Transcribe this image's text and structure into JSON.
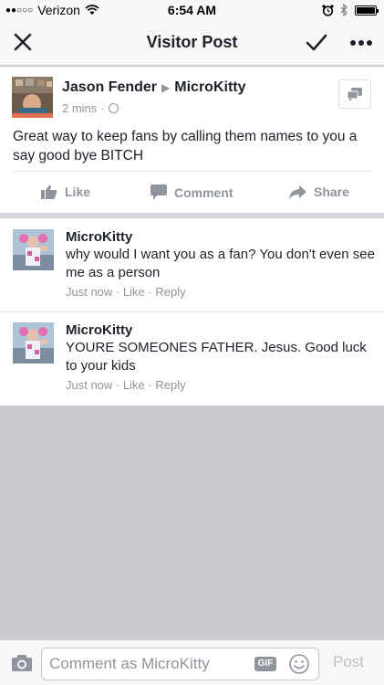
{
  "status_bar": {
    "signal_dots": "●●○○○",
    "carrier": "Verizon",
    "time": "6:54 AM"
  },
  "nav": {
    "title": "Visitor Post"
  },
  "post": {
    "author": "Jason Fender",
    "target": "MicroKitty",
    "time": "2 mins",
    "text": "Great way to keep fans by calling them names to you a say good bye BITCH",
    "actions": {
      "like": "Like",
      "comment": "Comment",
      "share": "Share"
    }
  },
  "comments": [
    {
      "author": "MicroKitty",
      "text": "why would I want you as a fan? You don't even see me as a person",
      "time": "Just now",
      "like": "Like",
      "reply": "Reply"
    },
    {
      "author": "MicroKitty",
      "text": "YOURE SOMEONES FATHER. Jesus. Good luck to your kids",
      "time": "Just now",
      "like": "Like",
      "reply": "Reply"
    }
  ],
  "composer": {
    "placeholder": "Comment as MicroKitty",
    "gif_label": "GIF",
    "post_label": "Post"
  },
  "colors": {
    "text": "#1d2129",
    "secondary": "#90949c",
    "background": "#c9cbd0"
  }
}
